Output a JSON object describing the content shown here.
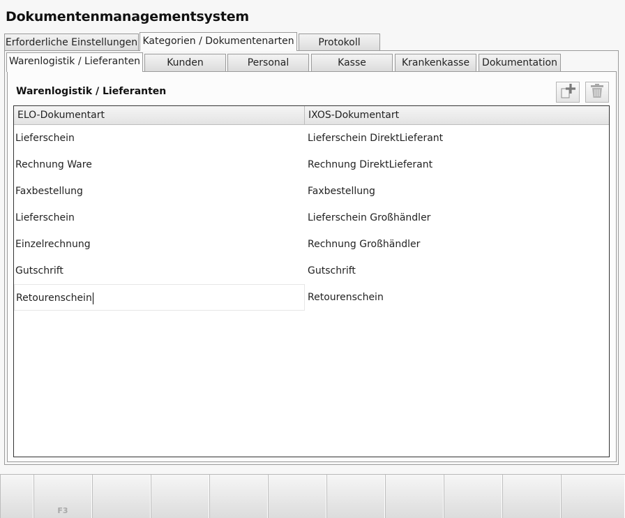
{
  "app_title": "Dokumentenmanagementsystem",
  "main_tabs": [
    {
      "label": "Erforderliche Einstellungen",
      "active": false
    },
    {
      "label": "Kategorien / Dokumentenarten",
      "active": true
    },
    {
      "label": "Protokoll",
      "active": false
    }
  ],
  "sub_tabs": [
    {
      "label": "Warenlogistik / Lieferanten",
      "active": true
    },
    {
      "label": "Kunden",
      "active": false
    },
    {
      "label": "Personal",
      "active": false
    },
    {
      "label": "Kasse",
      "active": false
    },
    {
      "label": "Krankenkasse",
      "active": false
    },
    {
      "label": "Dokumentation",
      "active": false
    }
  ],
  "section": {
    "title": "Warenlogistik / Lieferanten",
    "add_icon": "add-document-icon",
    "delete_icon": "trash-icon"
  },
  "table": {
    "columns": [
      "ELO-Dokumentart",
      "IXOS-Dokumentart"
    ],
    "rows": [
      [
        "Lieferschein",
        "Lieferschein DirektLieferant"
      ],
      [
        "Rechnung Ware",
        "Rechnung DirektLieferant"
      ],
      [
        "Faxbestellung",
        "Faxbestellung"
      ],
      [
        "Lieferschein",
        "Lieferschein Großhändler"
      ],
      [
        "Einzelrechnung",
        "Rechnung Großhändler"
      ],
      [
        "Gutschrift",
        "Gutschrift"
      ],
      [
        "Retourenschein",
        "Retourenschein"
      ]
    ]
  },
  "function_bar": {
    "keys": [
      "",
      "F3",
      "",
      "",
      "",
      "",
      "",
      "",
      "",
      "",
      ""
    ]
  }
}
